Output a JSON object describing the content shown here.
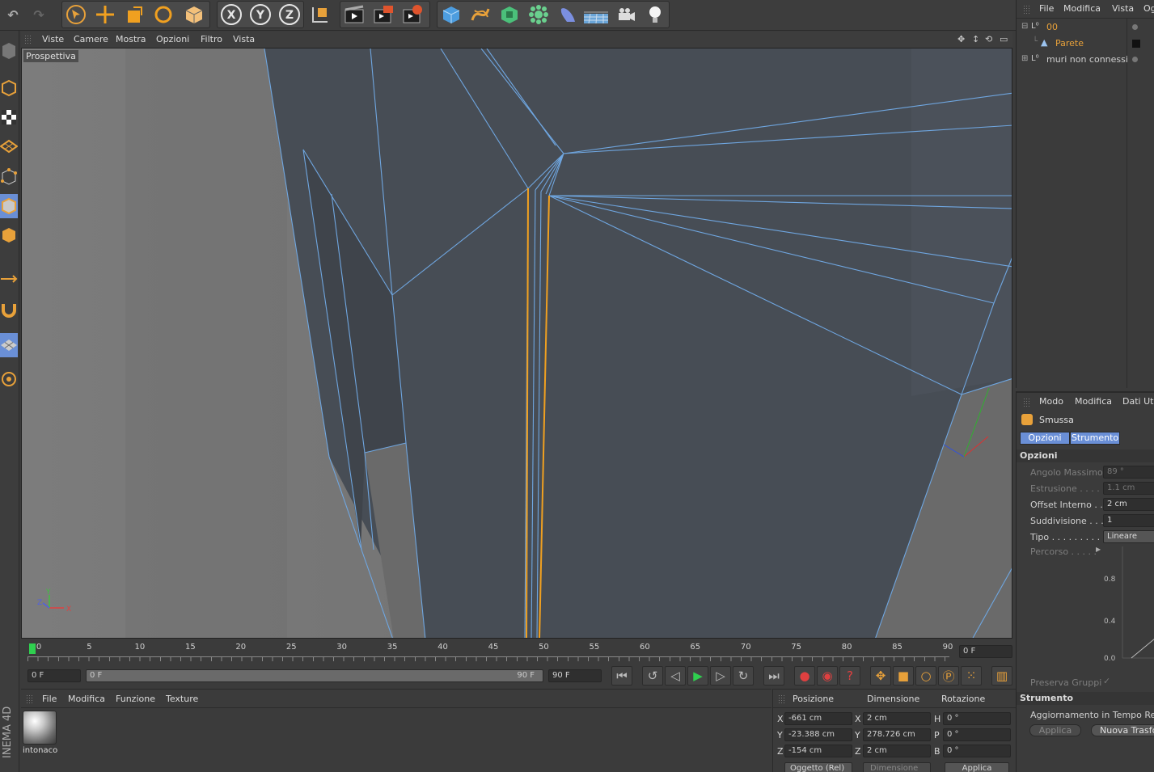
{
  "app": {
    "side_logo": "INEMA 4D"
  },
  "toolbar": {
    "icons": [
      "undo-icon",
      "redo-icon",
      "select-icon",
      "move-icon",
      "scale-icon",
      "rotate-icon",
      "object-icon",
      "x-axis-icon",
      "y-axis-icon",
      "z-axis-icon",
      "coordinate-system-icon",
      "render-view-icon",
      "render-picture-viewer-icon",
      "render-settings-icon",
      "cube-icon",
      "spline-icon",
      "nurbs-icon",
      "array-icon",
      "deformer-icon",
      "floor-icon",
      "camera-icon",
      "light-icon"
    ],
    "axis_labels": [
      "X",
      "Y",
      "Z"
    ]
  },
  "viewport": {
    "menu": [
      "Viste",
      "Camere",
      "Mostra",
      "Opzioni",
      "Filtro",
      "Vista"
    ],
    "label": "Prospettiva",
    "axes": {
      "x": "X",
      "y": "Y",
      "z": "Z"
    }
  },
  "timeline": {
    "ticks": [
      "0",
      "5",
      "10",
      "15",
      "20",
      "25",
      "30",
      "35",
      "40",
      "45",
      "50",
      "55",
      "60",
      "65",
      "70",
      "75",
      "80",
      "85",
      "90"
    ],
    "current_frame": "0 F",
    "start_field": "0 F",
    "range_start": "0 F",
    "range_end": "90 F",
    "end_field": "90 F"
  },
  "materials": {
    "menu": [
      "File",
      "Modifica",
      "Funzione",
      "Texture"
    ],
    "items": [
      {
        "name": "intonaco"
      }
    ]
  },
  "coordinates": {
    "headers": [
      "Posizione",
      "Dimensione",
      "Rotazione"
    ],
    "rows": [
      {
        "axis": "X",
        "pos": "-661 cm",
        "dim_axis": "X",
        "dim": "2 cm",
        "rot_axis": "H",
        "rot": "0 °"
      },
      {
        "axis": "Y",
        "pos": "-23.388 cm",
        "dim_axis": "Y",
        "dim": "278.726 cm",
        "rot_axis": "P",
        "rot": "0 °"
      },
      {
        "axis": "Z",
        "pos": "-154 cm",
        "dim_axis": "Z",
        "dim": "2 cm",
        "rot_axis": "B",
        "rot": "0 °"
      }
    ],
    "mode_select": "Oggetto (Rel)",
    "dim_select": "Dimensione",
    "apply": "Applica"
  },
  "object_manager": {
    "menu": [
      "File",
      "Modifica",
      "Vista",
      "Og"
    ],
    "objects": [
      {
        "name": "00",
        "color": "#e8a13a"
      },
      {
        "name": "Parete",
        "color": "#e8a13a"
      },
      {
        "name": "muri non connessi",
        "color": "#cfcfcf"
      }
    ]
  },
  "attributes": {
    "menu": [
      "Modo",
      "Modifica",
      "Dati Ute"
    ],
    "tool_name": "Smussa",
    "tabs": [
      "Opzioni",
      "Strumento"
    ],
    "section_options": "Opzioni",
    "fields": [
      {
        "label": "Angolo Massimo",
        "value": "89 °",
        "enabled": false
      },
      {
        "label": "Estrusione . . . . .",
        "value": "1.1 cm",
        "enabled": false
      },
      {
        "label": "Offset Interno . .",
        "value": "2 cm",
        "enabled": true
      },
      {
        "label": "Suddivisione . . .",
        "value": "1",
        "enabled": true
      },
      {
        "label": "Tipo . . . . . . . . . .",
        "value": "Lineare",
        "enabled": true
      }
    ],
    "path_label": "Percorso . . . . .",
    "graph_labels": [
      "0.8",
      "0.4",
      "0.0"
    ],
    "preserve_groups": "Preserva Gruppi",
    "section_tool": "Strumento",
    "realtime_update": "Aggiornamento in Tempo Reale",
    "apply_button": "Applica",
    "new_transform_button": "Nuova Trasfo"
  },
  "colors": {
    "accent": "#e8a13a",
    "selection": "#6a8fd6",
    "wire": "#6fa6e0"
  }
}
